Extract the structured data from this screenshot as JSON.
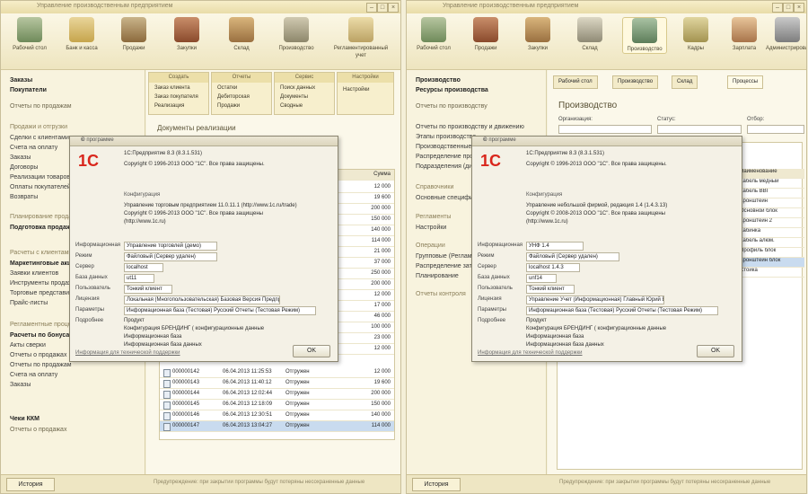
{
  "left_window": {
    "title": "Управление производственным предприятием",
    "sections": [
      {
        "label": "Рабочий стол"
      },
      {
        "label": "Банк и касса"
      },
      {
        "label": "Продажи"
      },
      {
        "label": "Закупки"
      },
      {
        "label": "Склад"
      },
      {
        "label": "Производство"
      },
      {
        "label": "Регламентированный учет"
      }
    ],
    "sidebar": [
      "Заказы",
      "Покупатели",
      "Отчеты по продажам",
      "Продажи и отгрузки",
      "Сделки с клиентами",
      "Счета на оплату",
      "Заказы",
      "Договоры",
      "Реализации товаров",
      "Оплаты покупателей",
      "Возвраты",
      "Планирование продаж",
      "Подготовка продаж",
      "Маркетинговые акции",
      "Расчеты с клиентами",
      "Заявки клиентов",
      "Инструменты продаж",
      "Торговые представители",
      "Прайс-листы",
      "Расчеты по бонусам",
      "Акты сверки",
      "Регламентные процедуры",
      "Чеки ККМ",
      "Отчеты о продажах"
    ],
    "panels": [
      {
        "title": "Создать",
        "items": [
          "Заказ клиента",
          "Заказ покупателя",
          "Реализация"
        ]
      },
      {
        "title": "Отчеты",
        "items": [
          "Остатки",
          "Дебиторская",
          "Продажи"
        ]
      },
      {
        "title": "Сервис",
        "items": [
          "Поиск данных",
          "Документы",
          "Сводные"
        ]
      },
      {
        "title": "Настройки",
        "items": [
          "Настройки"
        ]
      }
    ],
    "list_title": "Документы реализации",
    "list_rows": [
      {
        "num": "000000142",
        "date": "06.04.2013 11:25:53",
        "status": "Отгружен",
        "amount": "12 000"
      },
      {
        "num": "000000143",
        "date": "06.04.2013 11:40:12",
        "status": "Отгружен",
        "amount": "19 600"
      },
      {
        "num": "000000144",
        "date": "06.04.2013 12:02:44",
        "status": "Отгружен",
        "amount": "200 000"
      },
      {
        "num": "000000145",
        "date": "06.04.2013 12:18:09",
        "status": "Отгружен",
        "amount": "150 000"
      },
      {
        "num": "000000146",
        "date": "06.04.2013 12:30:51",
        "status": "Отгружен",
        "amount": "140 000"
      },
      {
        "num": "000000147",
        "date": "06.04.2013 13:04:27",
        "status": "Отгружен",
        "amount": "114 000"
      }
    ],
    "amounts_col": [
      "12 000",
      "19 600",
      "200 000",
      "150 000",
      "140 000",
      "114 000",
      "21 000",
      "37 000",
      "250 000",
      "200 000",
      "12 000",
      "17 000",
      "46 000",
      "100 000",
      "23 000",
      "12 000"
    ],
    "statusbar": {
      "history": "История",
      "text": "Предупреждение: при закрытии программы будут потеряны несохраненные данные"
    }
  },
  "left_dialog": {
    "title": "О программе",
    "line1": "1С:Предприятие 8.3 (8.3.1.531)",
    "line2": "Copyright © 1996-2013 ООО \"1С\". Все права защищены.",
    "config_head": "Конфигурация",
    "config_line1": "Управление торговым предприятием 11.0.11.1 (http://www.1c.ru/trade)",
    "config_line2": "Copyright © 1996-2013 ООО \"1С\". Все права защищены",
    "config_line3": "(http://www.1c.ru)",
    "fields": [
      {
        "label": "Информационная",
        "value": "Управление торговлей (демо)"
      },
      {
        "label": "Режим",
        "value": "Файловый (Сервер удален)"
      },
      {
        "label": "Сервер",
        "value": "localhost"
      },
      {
        "label": "База данных",
        "value": "ut11"
      },
      {
        "label": "Пользователь",
        "value": "Тонкий клиент"
      },
      {
        "label": "Лицензия",
        "value": "Локальная (Многопользовательская) Базовая Версия Предприятия"
      },
      {
        "label": "Параметры",
        "value": "Информационная база (Тестовая) Русский Отчеты (Тестовая Режим)"
      },
      {
        "label": "Подробнее",
        "value": "Продукт"
      }
    ],
    "extra1": "Конфигурация БРЕНДИНГ ( конфигурационные данные",
    "extra2": "Информационная база",
    "extra3": "Информационная база данных",
    "link": "Информация для технической поддержки",
    "ok": "OK"
  },
  "right_window": {
    "title": "Управление производственным предприятием",
    "sections": [
      {
        "label": "Рабочий стол"
      },
      {
        "label": "Продажи"
      },
      {
        "label": "Закупки"
      },
      {
        "label": "Склад"
      },
      {
        "label": "Производство"
      },
      {
        "label": "Кадры"
      },
      {
        "label": "Зарплата"
      },
      {
        "label": "Администрирование"
      }
    ],
    "sidebar": [
      "Производство",
      "Ресурсы производства",
      "Отчеты по производству",
      "Отчеты по производству и движению",
      "Этапы производства",
      "Производственные",
      "Распределение производства",
      "Подразделения (диспетчеризация)",
      "Справочники",
      "Основные спецификации",
      "Регламенты",
      "Настройки",
      "Операции",
      "Групповые (Регламенты)",
      "Распределение затрат",
      "Планирование",
      "Отчеты контроля"
    ],
    "tabs": [
      "Рабочий стол",
      "Производство",
      "Склад",
      "Процессы"
    ],
    "page_title": "Производство",
    "field_labels": [
      "Организация:",
      "Статус:",
      "Отбор:"
    ],
    "right_list": [
      "Наименование",
      "Кабель медный",
      "Кабель ВВГ",
      "Кронштейн",
      "Основной блок",
      "Кронштейн 2",
      "Кабинка",
      "Кабель алюм.",
      "Профиль блок",
      "Кронштейн блок",
      "Стойка"
    ],
    "statusbar": {
      "history": "История",
      "text": "Предупреждение: при закрытии программы будут потеряны несохраненные данные"
    }
  },
  "right_dialog": {
    "title": "О программе",
    "line1": "1С:Предприятие 8.3 (8.3.1.531)",
    "line2": "Copyright © 1996-2013 ООО \"1С\". Все права защищены.",
    "config_head": "Конфигурация",
    "config_line1": "Управление небольшой фирмой, редакция 1.4 (1.4.3.13)",
    "config_line2": "Copyright © 2008-2013 ООО \"1С\". Все права защищены",
    "config_line3": "(http://www.1c.ru)",
    "fields": [
      {
        "label": "Информационная",
        "value": "УНФ 1.4"
      },
      {
        "label": "Режим",
        "value": "Файловый (Сервер удален)"
      },
      {
        "label": "Сервер",
        "value": "localhost 1.4.3"
      },
      {
        "label": "База данных",
        "value": "unf14"
      },
      {
        "label": "Пользователь",
        "value": "Тонкий клиент"
      },
      {
        "label": "Лицензия",
        "value": "Управление Учет (Информационная) Главный Юрий Владимирович"
      },
      {
        "label": "Параметры",
        "value": "Информационная база (Тестовая) Русский Отчеты (Тестовая Режим)"
      },
      {
        "label": "Подробнее",
        "value": "Продукт"
      }
    ],
    "extra1": "Конфигурация БРЕНДИНГ ( конфигурационные данные",
    "extra2": "Информационная база",
    "extra3": "Информационная база данных",
    "link": "Информация для технической поддержки",
    "ok": "OK"
  },
  "colors": {
    "accent": "#e8dca6",
    "logo_red": "#d9261c",
    "selection": "#c9dbef"
  }
}
